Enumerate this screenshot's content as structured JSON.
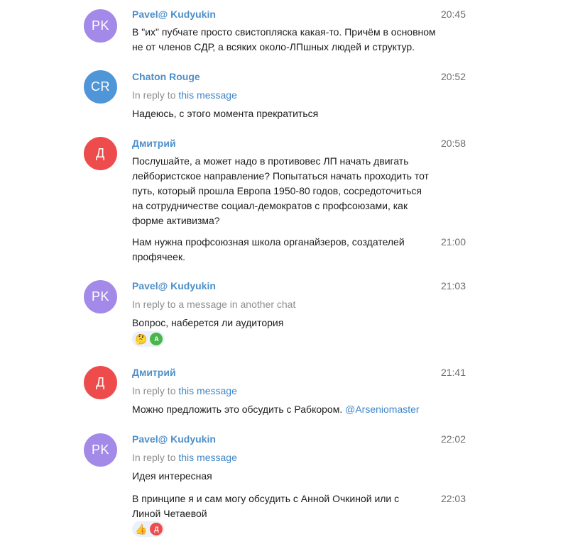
{
  "colors": {
    "avatar_pk": "#a48ae8",
    "avatar_cr": "#4f96d8",
    "avatar_d": "#ee4c4c",
    "reaction_a": "#4ab54a",
    "link": "#3f86c8",
    "sender_name": "#4d8fc9"
  },
  "messages": [
    {
      "avatar": "PK",
      "sender": "Pavel@ Kudyukin",
      "time": "20:45",
      "text": "В \"их\" пубчате просто свистопляска какая-то. Причём в основном не от членов СДР, а всяких около-ЛПшных людей и структур."
    },
    {
      "avatar": "CR",
      "sender": "Chaton Rouge",
      "time": "20:52",
      "reply_prefix": "In reply to ",
      "reply_link": "this message",
      "text": "Надеюсь, с этого момента прекратиться"
    },
    {
      "avatar": "Д",
      "sender": "Дмитрий",
      "time": "20:58",
      "text": "Послушайте, а может надо в противовес ЛП начать двигать лейбористское направление? Попытаться начать проходить тот путь, который прошла Европа 1950-80 годов, сосредоточиться на сотрудничестве социал-демократов с профсоюзами, как форме активизма?",
      "followup_text": "Нам нужна профсоюзная школа органайзеров, создателей профячеек.",
      "followup_time": "21:00"
    },
    {
      "avatar": "PK",
      "sender": "Pavel@ Kudyukin",
      "time": "21:03",
      "reply_text": "In reply to a message in another chat",
      "text": "Вопрос, наберется ли аудитория",
      "reaction_emoji": "🤔",
      "reaction_user": "A",
      "reaction_icon": "thinking-face-icon"
    },
    {
      "avatar": "Д",
      "sender": "Дмитрий",
      "time": "21:41",
      "reply_prefix": "In reply to ",
      "reply_link": "this message",
      "text": "Можно предложить это обсудить с Рабкором. ",
      "mention": "@Arseniomaster"
    },
    {
      "avatar": "PK",
      "sender": "Pavel@ Kudyukin",
      "time": "22:02",
      "reply_prefix": "In reply to ",
      "reply_link": "this message",
      "text": "Идея интересная",
      "followup_text": "В принципе я и сам могу обсудить с Анной Очкиной или с Линой Четаевой",
      "followup_time": "22:03",
      "reaction_emoji": "👍",
      "reaction_user": "Д",
      "reaction_icon": "thumbs-up-icon"
    }
  ]
}
